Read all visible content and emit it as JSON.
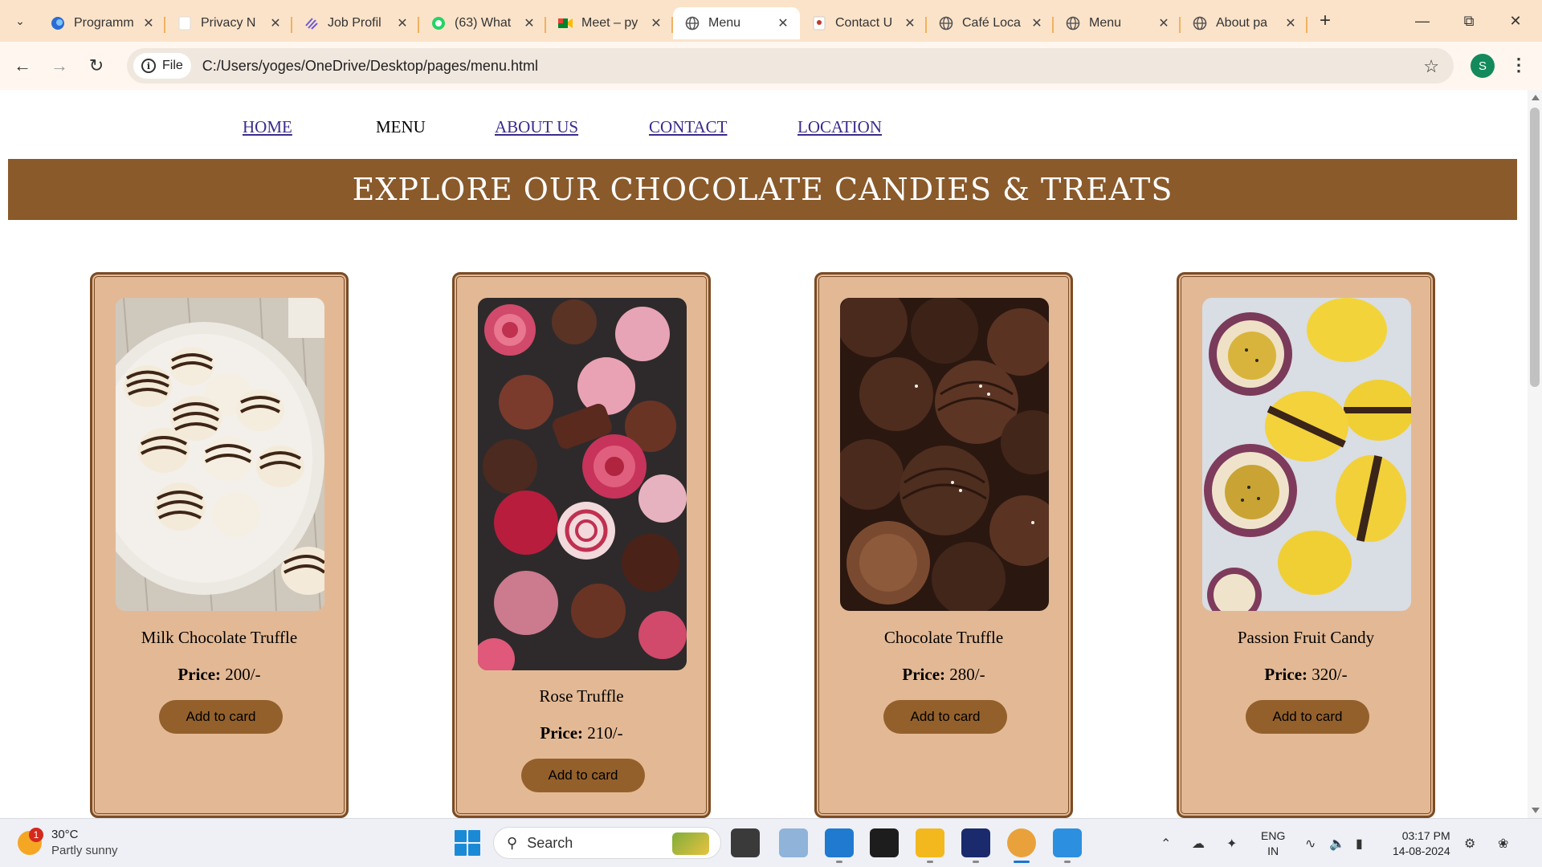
{
  "browser": {
    "tabs": [
      {
        "title": "Programm",
        "icon": "edge-blue-icon",
        "active": false
      },
      {
        "title": "Privacy N",
        "icon": "blank-page-icon",
        "active": false
      },
      {
        "title": "Job Profil",
        "icon": "stripes-logo-icon",
        "active": false
      },
      {
        "title": "(63) What",
        "icon": "whatsapp-icon",
        "active": false
      },
      {
        "title": "Meet – py",
        "icon": "google-meet-icon",
        "active": false
      },
      {
        "title": "Menu",
        "icon": "globe-icon",
        "active": true
      },
      {
        "title": "Contact U",
        "icon": "contact-page-icon",
        "active": false
      },
      {
        "title": "Café Loca",
        "icon": "globe-icon",
        "active": false
      },
      {
        "title": "Menu",
        "icon": "globe-icon",
        "active": false
      },
      {
        "title": "About pa",
        "icon": "globe-icon",
        "active": false
      }
    ],
    "file_chip": "File",
    "url": "C:/Users/yoges/OneDrive/Desktop/pages/menu.html",
    "profile_initial": "S"
  },
  "site": {
    "nav": [
      {
        "label": "HOME",
        "current": false
      },
      {
        "label": "MENU",
        "current": true
      },
      {
        "label": "ABOUT US",
        "current": false
      },
      {
        "label": "CONTACT",
        "current": false
      },
      {
        "label": "LOCATION",
        "current": false
      }
    ],
    "banner": "EXPLORE OUR CHOCOLATE CANDIES & TREATS",
    "price_label": "Price:",
    "products": [
      {
        "name": "Milk Chocolate Truffle",
        "price": "200/-",
        "button": "Add to card"
      },
      {
        "name": "Rose Truffle",
        "price": "210/-",
        "button": "Add to card"
      },
      {
        "name": "Chocolate Truffle",
        "price": "280/-",
        "button": "Add to card"
      },
      {
        "name": "Passion Fruit Candy",
        "price": "320/-",
        "button": "Add to card"
      }
    ]
  },
  "taskbar": {
    "weather_temp": "30°C",
    "weather_desc": "Partly sunny",
    "weather_badge": "1",
    "search_placeholder": "Search",
    "lang_top": "ENG",
    "lang_bottom": "IN",
    "time": "03:17 PM",
    "date": "14-08-2024"
  },
  "colors": {
    "tabbar_bg": "#fbe3c9",
    "banner_bg": "#8a5a2b",
    "card_bg": "#e3b995",
    "card_border": "#7a4c25",
    "button_bg": "#93602c"
  }
}
